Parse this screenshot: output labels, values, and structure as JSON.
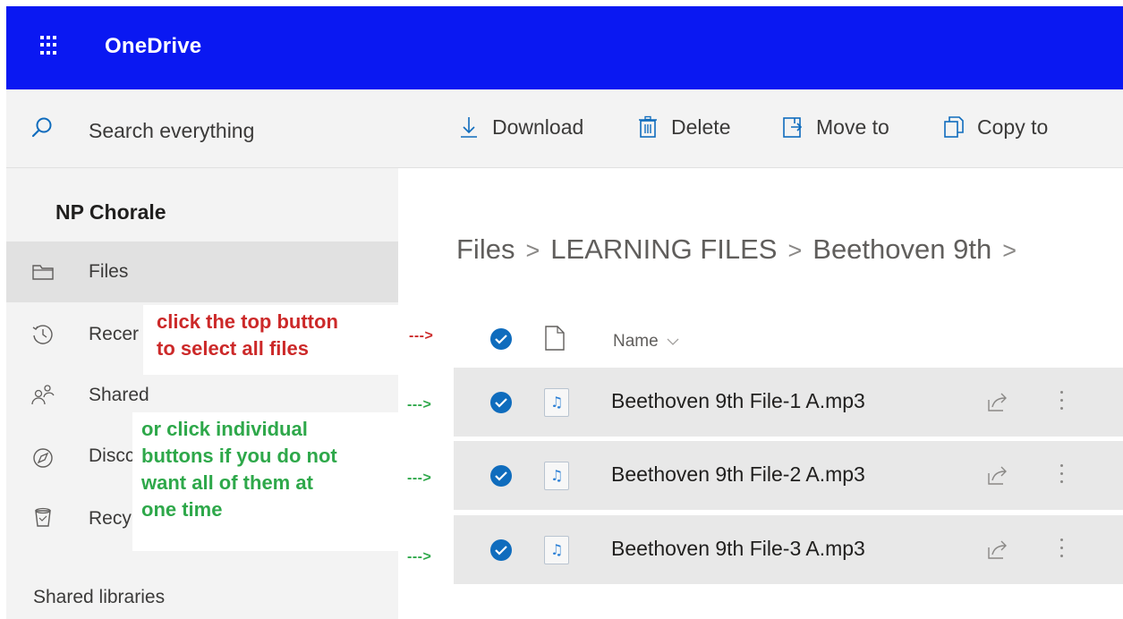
{
  "header": {
    "app_name": "OneDrive"
  },
  "search": {
    "placeholder": "Search everything"
  },
  "toolbar": {
    "download_label": "Download",
    "delete_label": "Delete",
    "move_label": "Move to",
    "copy_label": "Copy to"
  },
  "sidebar": {
    "group_title": "NP Chorale",
    "items": [
      {
        "label": "Files",
        "icon": "folder-icon",
        "active": true
      },
      {
        "label": "Recer",
        "icon": "clock-icon",
        "active": false
      },
      {
        "label": "Shared",
        "icon": "people-icon",
        "active": false
      },
      {
        "label": "Discc",
        "icon": "compass-icon",
        "active": false
      },
      {
        "label": "Recy",
        "icon": "trash-icon",
        "active": false
      }
    ],
    "shared_libraries_label": "Shared libraries"
  },
  "breadcrumb": {
    "items": [
      "Files",
      "LEARNING FILES",
      "Beethoven 9th"
    ],
    "separator": ">"
  },
  "file_list": {
    "name_header": "Name",
    "files": [
      {
        "name": "Beethoven 9th File-1 A.mp3",
        "selected": true
      },
      {
        "name": "Beethoven 9th File-2 A.mp3",
        "selected": true
      },
      {
        "name": "Beethoven 9th File-3 A.mp3",
        "selected": true
      }
    ]
  },
  "annotations": {
    "select_all_line1": "click the top button",
    "select_all_line2": "to select all files",
    "individual_line1": "or click individual",
    "individual_line2": "buttons if you do not",
    "individual_line3": "want all of them at",
    "individual_line4": "one time",
    "arrow": "--->"
  },
  "colors": {
    "topbar": "#0a18f2",
    "accent": "#0f6cbd",
    "annotation_red": "#cc2929",
    "annotation_green": "#2ea84a"
  }
}
